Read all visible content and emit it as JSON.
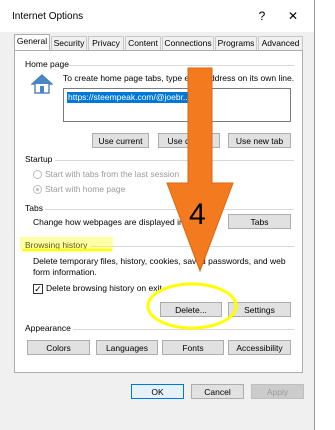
{
  "window": {
    "title": "Internet Options",
    "help_label": "?",
    "close_label": "✕"
  },
  "tabs": [
    {
      "label": "General"
    },
    {
      "label": "Security"
    },
    {
      "label": "Privacy"
    },
    {
      "label": "Content"
    },
    {
      "label": "Connections"
    },
    {
      "label": "Programs"
    },
    {
      "label": "Advanced"
    }
  ],
  "home_page": {
    "label": "Home page",
    "description": "To create home page tabs, type each address on its own line.",
    "url": "https://steempeak.com/@joebr...ed",
    "use_current": "Use current",
    "use_default": "Use default",
    "use_new_tab": "Use new tab"
  },
  "startup": {
    "label": "Startup",
    "option_tabs": "Start with tabs from the last session",
    "option_home": "Start with home page"
  },
  "tabs_section": {
    "label": "Tabs",
    "description": "Change how webpages are displayed in tabs.",
    "button": "Tabs"
  },
  "browsing_history": {
    "label": "Browsing history",
    "description": "Delete temporary files, history, cookies, saved passwords, and web form information.",
    "checkbox_label": "Delete browsing history on exit",
    "delete_button": "Delete...",
    "settings_button": "Settings"
  },
  "appearance": {
    "label": "Appearance",
    "colors": "Colors",
    "languages": "Languages",
    "fonts": "Fonts",
    "accessibility": "Accessibility"
  },
  "footer": {
    "ok": "OK",
    "cancel": "Cancel",
    "apply": "Apply"
  },
  "annotation": {
    "step_number": "4",
    "arrow_color": "#f47a20",
    "highlight_color": "#ffff00"
  }
}
